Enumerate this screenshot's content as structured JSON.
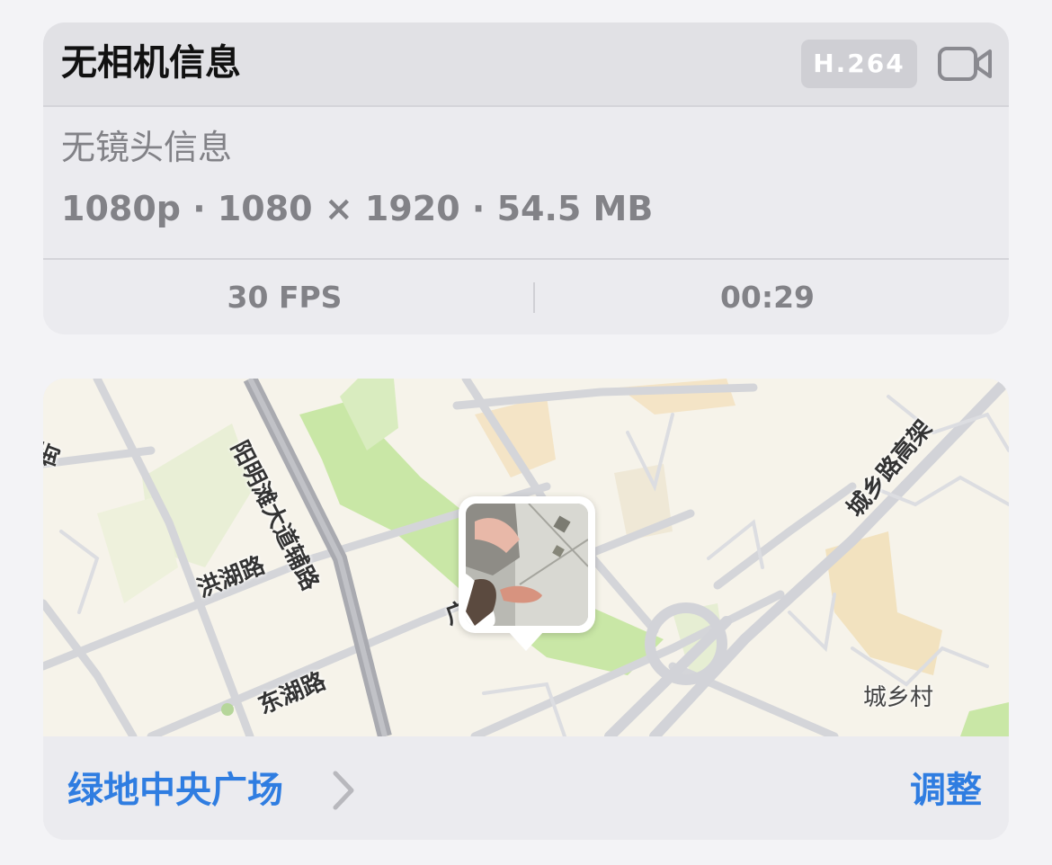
{
  "info": {
    "title": "无相机信息",
    "codec": "H.264",
    "lens": "无镜头信息",
    "specs": "1080p · 1080 × 1920 · 54.5 MB",
    "fps": "30 FPS",
    "duration": "00:29"
  },
  "map": {
    "labels": {
      "yangming": "阳明滩大道辅路",
      "honghu": "洪湖路",
      "donghu": "东湖路",
      "chengxiang_viaduct": "城乡路高架",
      "chengxiang_village": "城乡村",
      "edge_left": "街",
      "edge_center": "广"
    },
    "colors": {
      "land": "#f6f3ea",
      "park": "#c9e7a6",
      "road": "#d4d5d9",
      "highway": "#a9aab0",
      "accent": "#2f7de1"
    }
  },
  "footer": {
    "place": "绿地中央广场",
    "adjust": "调整"
  },
  "icons": {
    "video": "video-camera-icon",
    "chevron": "chevron-right-icon"
  }
}
